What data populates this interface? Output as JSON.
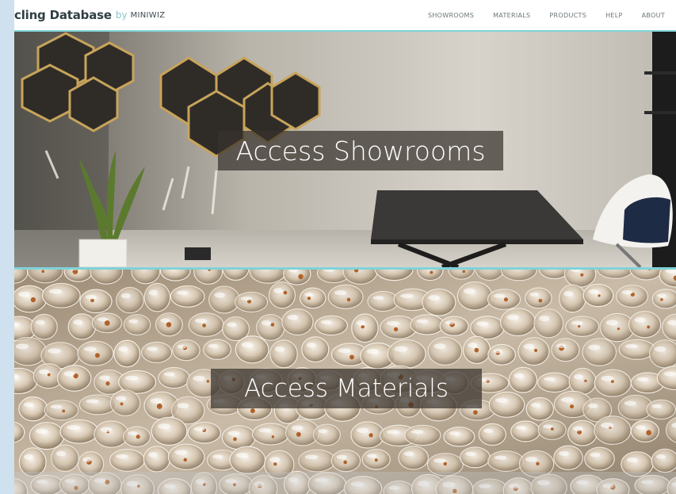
{
  "header": {
    "brand_main": "cling Database",
    "brand_by": "by",
    "brand_org": "MINIWIZ",
    "nav": [
      "SHOWROOMS",
      "MATERIALS",
      "PRODUCTS",
      "HELP",
      "ABOUT"
    ]
  },
  "hero": {
    "showrooms_cta": "Access Showrooms",
    "materials_cta": "Access Materials"
  },
  "colors": {
    "accent": "#7fd3d9",
    "page_background": "#cfe0ee",
    "overlay": "rgba(55,50,45,0.72)"
  }
}
